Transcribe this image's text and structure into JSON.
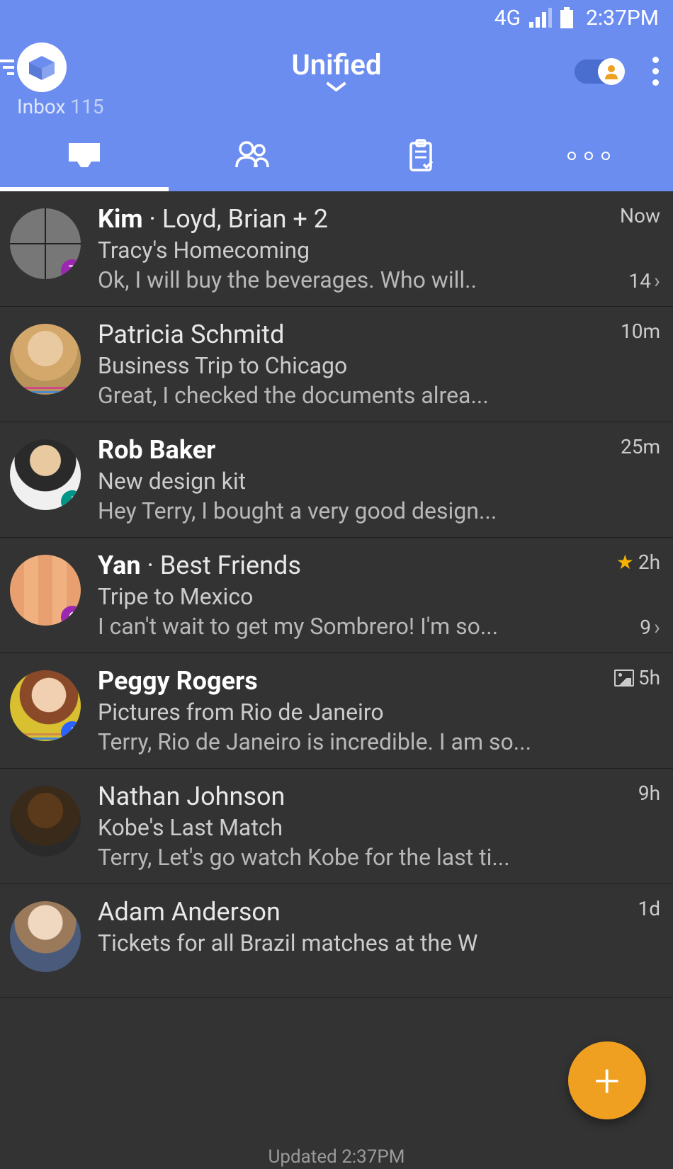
{
  "status": {
    "network": "4G",
    "time": "2:37PM"
  },
  "header": {
    "title": "Unified",
    "inbox_label": "Inbox",
    "inbox_count": "115"
  },
  "emails": [
    {
      "sender_bold": "Kim",
      "sender_rest": " · Loyd, Brian + 2",
      "subject": "Tracy's Homecoming",
      "preview": "Ok, I will buy the beverages. Who will..",
      "time": "Now",
      "thread_count": "14",
      "badge": "7",
      "badge_color": "#9c27b0",
      "has_chevron": true
    },
    {
      "sender_bold": "",
      "sender_rest": "Patricia Schmitd",
      "subject": "Business Trip to Chicago",
      "preview": "Great, I checked the documents alrea...",
      "time": "10m",
      "stripes": [
        "#d04a8a",
        "#4a8ad0",
        "#d08a4a"
      ]
    },
    {
      "sender_bold": "Rob Baker",
      "sender_rest": "",
      "subject": "New design kit",
      "preview": "Hey Terry, I bought a very good design...",
      "time": "25m",
      "badge": "|",
      "badge_color": "#009688"
    },
    {
      "sender_bold": "Yan",
      "sender_rest": " · Best Friends",
      "subject": "Tripe to Mexico",
      "preview": "I can't wait to get my Sombrero! I'm so...",
      "time": "2h",
      "thread_count": "9",
      "badge": "6",
      "badge_color": "#9c27b0",
      "starred": true,
      "has_chevron": true
    },
    {
      "sender_bold": "Peggy Rogers",
      "sender_rest": "",
      "subject": "Pictures from Rio de Janeiro",
      "preview": "Terry, Rio de Janeiro is incredible. I am so...",
      "time": "5h",
      "badge": "|",
      "badge_color": "#2962ff",
      "has_attachment": true,
      "stripes": [
        "#d08a4a",
        "#4a8ad0",
        "#d04a8a"
      ]
    },
    {
      "sender_bold": "",
      "sender_rest": "Nathan Johnson",
      "subject": "Kobe's Last Match",
      "preview": "Terry, Let's go watch Kobe for the last ti...",
      "time": "9h"
    },
    {
      "sender_bold": "",
      "sender_rest": "Adam Anderson",
      "subject": "Tickets for all Brazil matches at the W",
      "preview": "",
      "time": "1d"
    }
  ],
  "footer": {
    "text": "Updated 2:37PM"
  }
}
